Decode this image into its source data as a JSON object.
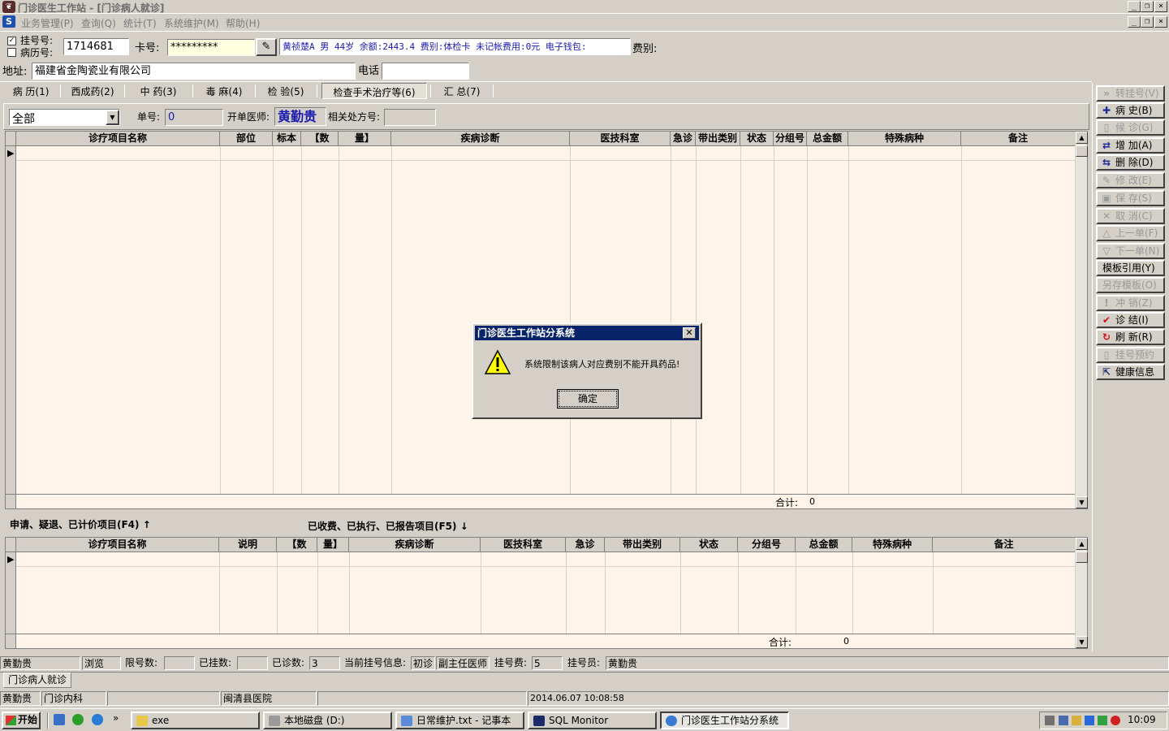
{
  "window": {
    "title": "门诊医生工作站 - [门诊病人就诊]"
  },
  "menu": [
    "业务管理(P)",
    "查询(Q)",
    "统计(T)",
    "系统维护(M)",
    "帮助(H)"
  ],
  "patient": {
    "reg_checkbox_label": "挂号号:",
    "record_checkbox_label": "病历号:",
    "reg_checked": "✓",
    "reg_number": "1714681",
    "card_label": "卡号:",
    "card_value": "*********",
    "info": "黄祯楚A 男 44岁 余额:2443.4 费别:体检卡 未记帐费用:0元 电子钱包:",
    "fee_type_label": "费别:",
    "address_label": "地址:",
    "address_value": "福建省金陶瓷业有限公司",
    "phone_label": "电话",
    "phone_value": ""
  },
  "tabs": [
    "病 历(1)",
    "西成药(2)",
    "中 药(3)",
    "毒 麻(4)",
    "检 验(5)",
    "检查手术治疗等(6)",
    "汇 总(7)"
  ],
  "active_tab": "检查手术治疗等(6)",
  "filter": {
    "category": "全部",
    "order_no_label": "单号:",
    "order_no": "0",
    "doctor_label": "开单医师:",
    "doctor": "黄勤贵",
    "related_label": "相关处方号:",
    "related_value": ""
  },
  "upper_grid": {
    "columns": [
      "诊疗项目名称",
      "部位",
      "标本",
      "【数",
      "量】",
      "疾病诊断",
      "医技科室",
      "急诊",
      "带出类别",
      "状态",
      "分组号",
      "总金额",
      "特殊病种",
      "备注"
    ],
    "total_label": "合计:",
    "total_value": "0"
  },
  "section_labels": {
    "pending": "申请、疑退、已计价项目(F4)",
    "pending_arrow": "↑",
    "done": "已收费、已执行、已报告项目(F5)",
    "done_arrow": "↓"
  },
  "lower_grid": {
    "columns": [
      "诊疗项目名称",
      "说明",
      "【数",
      "量】",
      "疾病诊断",
      "医技科室",
      "急诊",
      "带出类别",
      "状态",
      "分组号",
      "总金额",
      "特殊病种",
      "备注"
    ],
    "total_label": "合计:",
    "total_value": "0"
  },
  "right_buttons": [
    {
      "label": "转挂号(V)",
      "icon": "»",
      "enabled": false
    },
    {
      "label": "病 史(B)",
      "icon": "✚",
      "enabled": true
    },
    {
      "label": "候 诊(G)",
      "icon": "▯",
      "enabled": false
    },
    {
      "label": "增 加(A)",
      "icon": "⇄",
      "enabled": true
    },
    {
      "label": "删 除(D)",
      "icon": "⇆",
      "enabled": true
    },
    {
      "label": "修 改(E)",
      "icon": "✎",
      "enabled": false
    },
    {
      "label": "保 存(S)",
      "icon": "▣",
      "enabled": false
    },
    {
      "label": "取 消(C)",
      "icon": "✕",
      "enabled": false
    },
    {
      "label": "上一单(F)",
      "icon": "△",
      "enabled": false
    },
    {
      "label": "下一单(N)",
      "icon": "▽",
      "enabled": false
    },
    {
      "label": "模板引用(Y)",
      "icon": "",
      "enabled": true
    },
    {
      "label": "另存模板(O)",
      "icon": "",
      "enabled": false
    },
    {
      "label": "冲 销(Z)",
      "icon": "!",
      "enabled": false
    },
    {
      "label": "诊 结(I)",
      "icon": "✔",
      "enabled": true
    },
    {
      "label": "刷 新(R)",
      "icon": "↻",
      "enabled": true
    },
    {
      "label": "挂号预约",
      "icon": "▯",
      "enabled": false
    },
    {
      "label": "健康信息",
      "icon": "⇱",
      "enabled": true
    }
  ],
  "status1": {
    "user": "黄勤贵",
    "mode": "浏览",
    "limit_label": "限号数:",
    "limit_value": "",
    "registered_label": "已挂数:",
    "registered_value": "",
    "seen_label": "已诊数:",
    "seen_value": "3",
    "curinfo_label": "当前挂号信息:",
    "visit_type": "初诊",
    "doctor_title": "副主任医师",
    "fee_label": "挂号费:",
    "fee_value": "5",
    "clerk_label": "挂号员:",
    "clerk_value": "黄勤贵"
  },
  "doc_tab": "门诊病人就诊",
  "status2": {
    "user": "黄勤贵",
    "dept": "门诊内科",
    "hospital": "闽清县医院",
    "datetime": "2014.06.07 10:08:58"
  },
  "dialog": {
    "title": "门诊医生工作站分系统",
    "message": "系统限制该病人对应费别不能开具药品!",
    "ok": "确定"
  },
  "taskbar": {
    "start": "开始",
    "items": [
      "exe",
      "本地磁盘 (D:)",
      "日常维护.txt - 记事本",
      "SQL Monitor",
      "门诊医生工作站分系统"
    ],
    "clock": "10:09"
  }
}
